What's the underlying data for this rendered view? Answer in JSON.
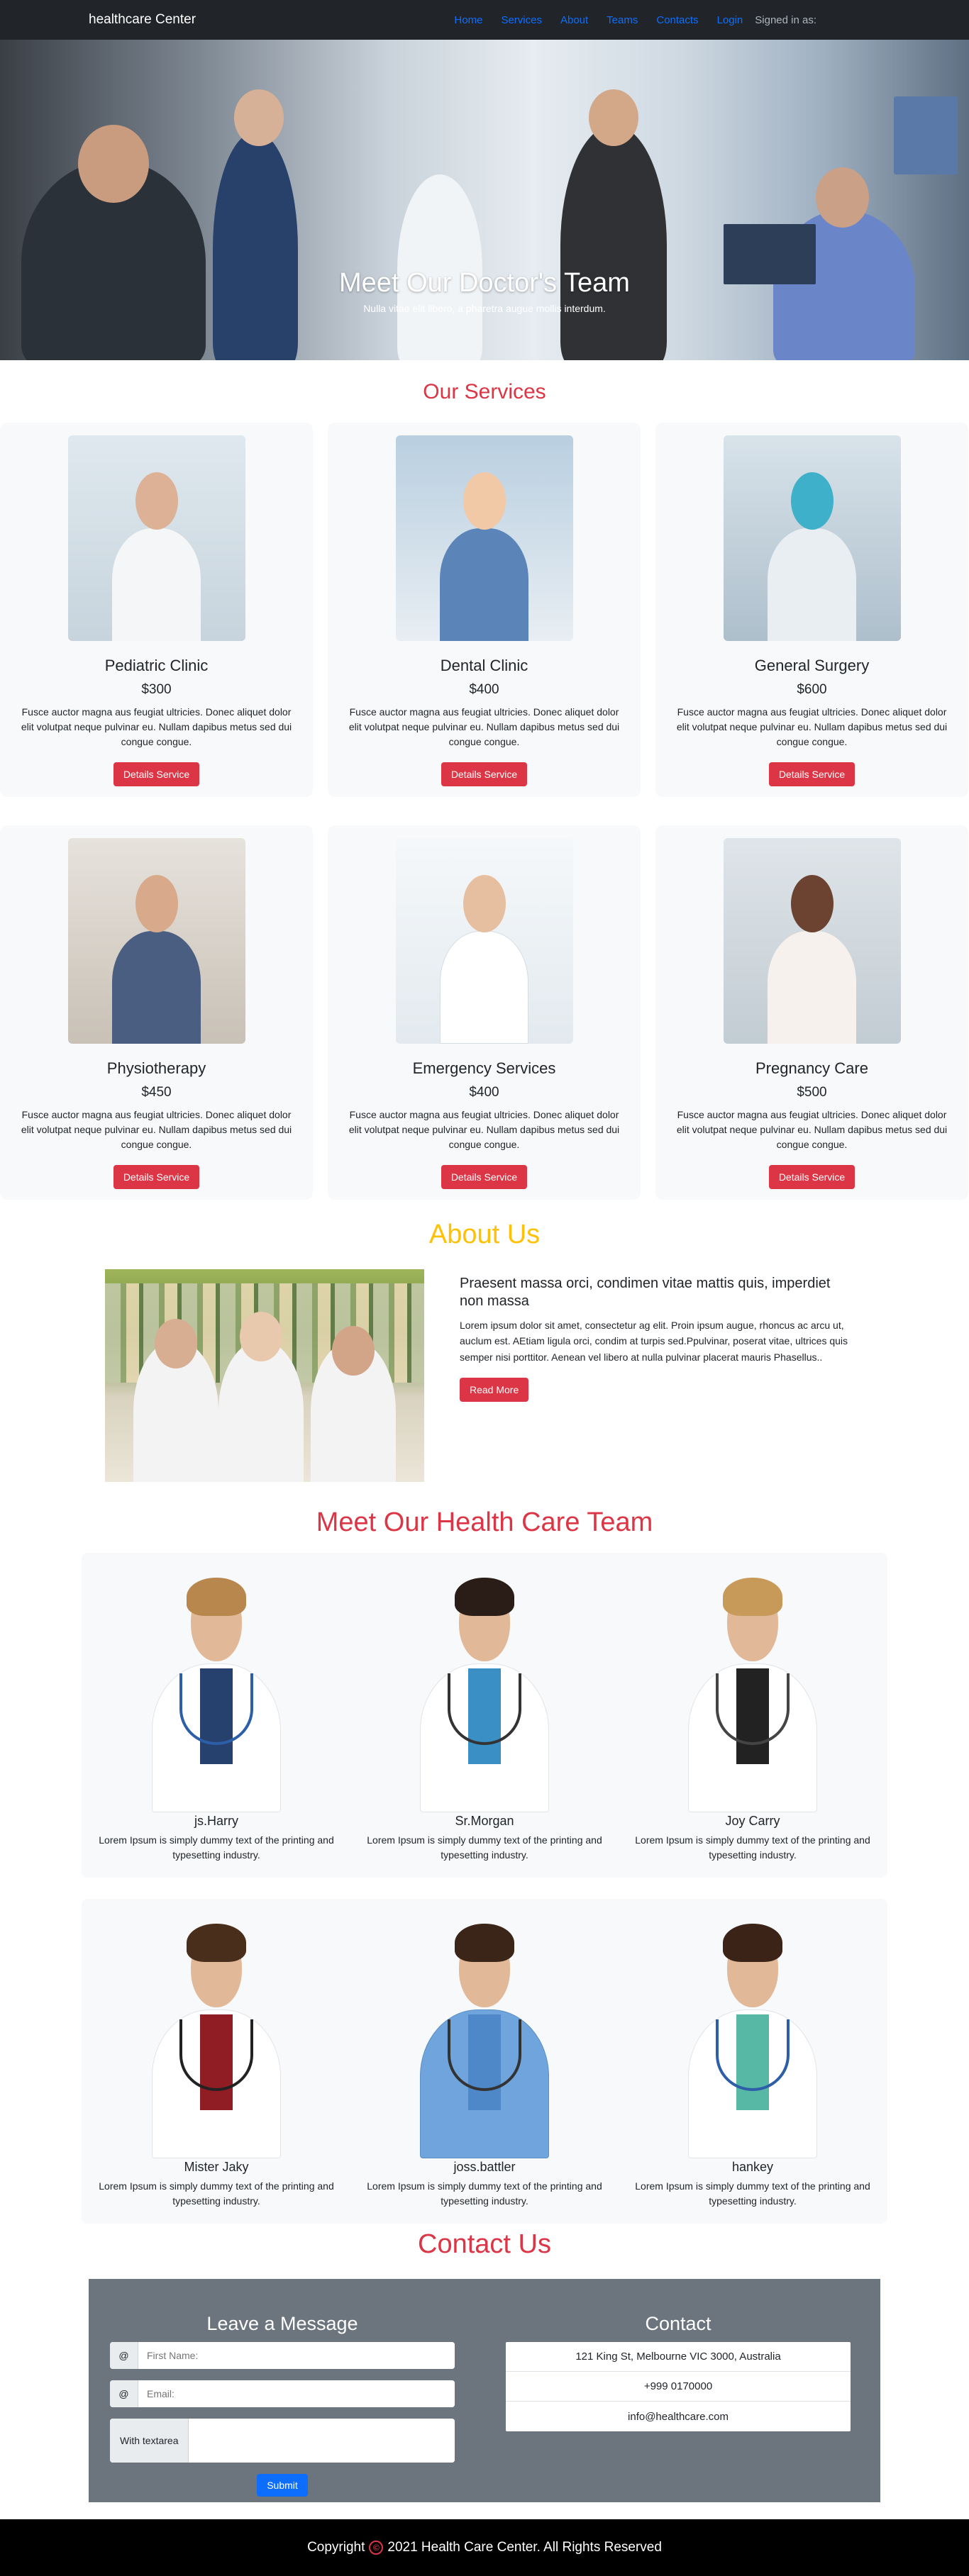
{
  "nav": {
    "brand": "healthcare Center",
    "links": [
      "Home",
      "Services",
      "About",
      "Teams",
      "Contacts",
      "Login"
    ],
    "signed_in": "Signed in as:"
  },
  "hero": {
    "title": "Meet Our Doctor's Team",
    "subtitle": "Nulla vitae elit libero, a pharetra augue mollis interdum.",
    "slides": 3,
    "active_slide": 2
  },
  "services": {
    "title": "Our Services",
    "button_label": "Details Service",
    "items": [
      {
        "name": "Pediatric Clinic",
        "price": "$300",
        "desc": "Fusce auctor magna aus feugiat ultricies. Donec aliquet dolor elit volutpat neque pulvinar eu. Nullam dapibus metus sed dui congue congue."
      },
      {
        "name": "Dental Clinic",
        "price": "$400",
        "desc": "Fusce auctor magna aus feugiat ultricies. Donec aliquet dolor elit volutpat neque pulvinar eu. Nullam dapibus metus sed dui congue congue."
      },
      {
        "name": "General Surgery",
        "price": "$600",
        "desc": "Fusce auctor magna aus feugiat ultricies. Donec aliquet dolor elit volutpat neque pulvinar eu. Nullam dapibus metus sed dui congue congue."
      },
      {
        "name": "Physiotherapy",
        "price": "$450",
        "desc": "Fusce auctor magna aus feugiat ultricies. Donec aliquet dolor elit volutpat neque pulvinar eu. Nullam dapibus metus sed dui congue congue."
      },
      {
        "name": "Emergency Services",
        "price": "$400",
        "desc": "Fusce auctor magna aus feugiat ultricies. Donec aliquet dolor elit volutpat neque pulvinar eu. Nullam dapibus metus sed dui congue congue."
      },
      {
        "name": "Pregnancy Care",
        "price": "$500",
        "desc": "Fusce auctor magna aus feugiat ultricies. Donec aliquet dolor elit volutpat neque pulvinar eu. Nullam dapibus metus sed dui congue congue."
      }
    ]
  },
  "about": {
    "title": "About Us",
    "heading": "Praesent massa orci, condimen vitae mattis quis, imperdiet non massa",
    "body": "Lorem ipsum dolor sit amet, consectetur ag elit. Proin ipsum augue, rhoncus ac arcu ut, auclum est. AEtiam ligula orci, condim at turpis sed.Ppulvinar, poserat vitae, ultrices quis semper nisi porttitor. Aenean vel libero at nulla pulvinar placerat mauris Phasellus..",
    "button_label": "Read More"
  },
  "team": {
    "title": "Meet Our Health Care Team",
    "members": [
      {
        "name": "js.Harry",
        "desc": "Lorem Ipsum is simply dummy text of the printing and typesetting industry."
      },
      {
        "name": "Sr.Morgan",
        "desc": "Lorem Ipsum is simply dummy text of the printing and typesetting industry."
      },
      {
        "name": "Joy Carry",
        "desc": "Lorem Ipsum is simply dummy text of the printing and typesetting industry."
      },
      {
        "name": "Mister Jaky",
        "desc": "Lorem Ipsum is simply dummy text of the printing and typesetting industry."
      },
      {
        "name": "joss.battler",
        "desc": "Lorem Ipsum is simply dummy text of the printing and typesetting industry."
      },
      {
        "name": "hankey",
        "desc": "Lorem Ipsum is simply dummy text of the printing and typesetting industry."
      }
    ]
  },
  "contact": {
    "title": "Contact Us",
    "form": {
      "heading": "Leave a Message",
      "addon_symbol": "@",
      "first_name_placeholder": "First Name:",
      "email_placeholder": "Email:",
      "textarea_label": "With textarea",
      "submit_label": "Submit"
    },
    "info": {
      "heading": "Contact",
      "address": "121 King St, Melbourne VIC 3000, Australia",
      "phone": "+999 0170000",
      "email": "info@healthcare.com"
    }
  },
  "footer": {
    "copyright_prefix": "Copyright",
    "copyright_symbol": "©",
    "text": "2021 Health Care Center. All Rights Reserved"
  },
  "colors": {
    "primary_red": "#dc3545",
    "about_yellow": "#ffc107",
    "link_blue": "#0d6efd",
    "navbar_dark": "#212529",
    "contact_gray": "#6c757d",
    "footer_black": "#000000"
  }
}
